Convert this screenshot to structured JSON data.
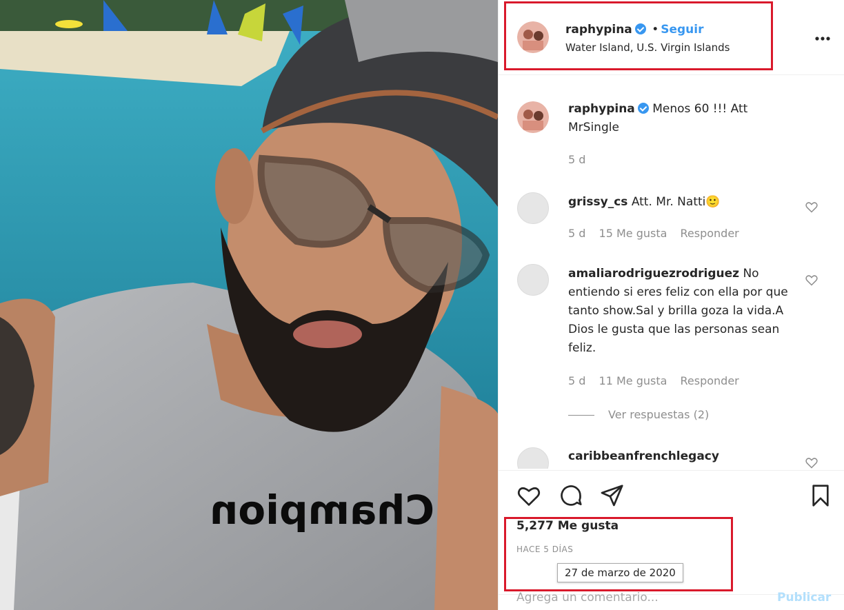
{
  "post": {
    "username": "raphypina",
    "follow_label": "Seguir",
    "separator": "•",
    "location": "Water Island, U.S. Virgin Islands",
    "more_icon": "more-horizontal-icon",
    "verified_icon": "verified-badge-icon",
    "caption": "Menos 60 !!! Att MrSingle",
    "caption_time": "5 d",
    "shirt_text": "Champion"
  },
  "comments": [
    {
      "username": "grissy_cs",
      "text": "Att. Mr. Natti🙂",
      "time": "5 d",
      "likes": "15 Me gusta",
      "reply": "Responder"
    },
    {
      "username": "amaliarodriguezrodriguez",
      "text": "No entiendo si eres feliz con ella por que tanto show.Sal y brilla goza la vida.A Dios le gusta que las personas sean feliz.",
      "time": "5 d",
      "likes": "11 Me gusta",
      "reply": "Responder",
      "view_replies": "Ver respuestas (2)"
    },
    {
      "username": "caribbeanfrenchlegacy"
    }
  ],
  "actions": {
    "like_icon": "heart-icon",
    "comment_icon": "comment-icon",
    "share_icon": "paper-plane-icon",
    "save_icon": "bookmark-icon",
    "likes_count": "5,277 Me gusta",
    "time_ago": "HACE 5 DÍAS",
    "tooltip_date": "27 de marzo de 2020"
  },
  "comment_box": {
    "placeholder": "Agrega un comentario...",
    "publish_label": "Publicar"
  },
  "colors": {
    "highlight": "#d9192b",
    "link_blue": "#3897f0",
    "muted": "#8e8e8e"
  }
}
